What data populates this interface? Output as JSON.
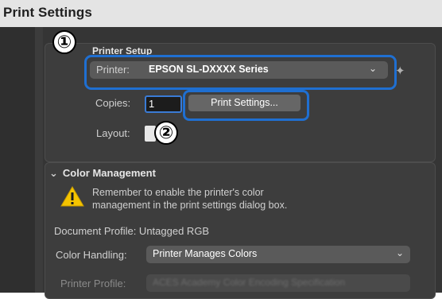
{
  "window": {
    "title": "Print Settings"
  },
  "printer_setup": {
    "section_label": "Printer Setup",
    "printer_label": "Printer:",
    "printer_value": "EPSON SL-DXXXX Series",
    "copies_label": "Copies:",
    "copies_value": "1",
    "print_settings_button": "Print Settings...",
    "layout_label": "Layout:"
  },
  "annotations": {
    "step1": "①",
    "step2": "②"
  },
  "color_management": {
    "section_label": "Color Management",
    "warning_line1": "Remember to enable the printer's color",
    "warning_line2": "management in the print settings dialog box.",
    "document_profile": "Document Profile: Untagged RGB",
    "color_handling_label": "Color Handling:",
    "color_handling_value": "Printer Manages Colors",
    "printer_profile_label": "Printer Profile:",
    "printer_profile_value": "ACES Academy Color Encoding Specification"
  },
  "colors": {
    "highlight": "#1f6fd1",
    "warning": "#f5c400"
  }
}
